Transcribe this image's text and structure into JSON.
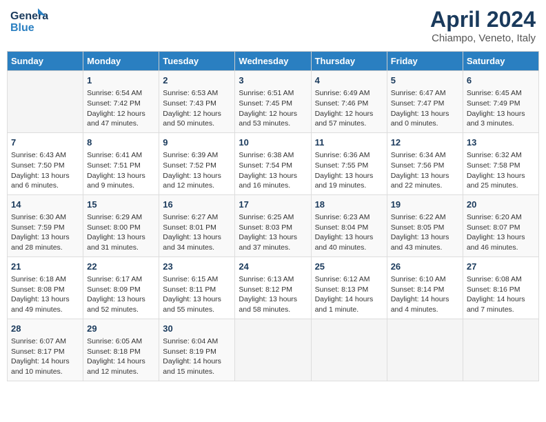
{
  "logo": {
    "line1": "General",
    "line2": "Blue"
  },
  "title": "April 2024",
  "subtitle": "Chiampo, Veneto, Italy",
  "weekdays": [
    "Sunday",
    "Monday",
    "Tuesday",
    "Wednesday",
    "Thursday",
    "Friday",
    "Saturday"
  ],
  "weeks": [
    [
      {
        "day": "",
        "info": ""
      },
      {
        "day": "1",
        "info": "Sunrise: 6:54 AM\nSunset: 7:42 PM\nDaylight: 12 hours\nand 47 minutes."
      },
      {
        "day": "2",
        "info": "Sunrise: 6:53 AM\nSunset: 7:43 PM\nDaylight: 12 hours\nand 50 minutes."
      },
      {
        "day": "3",
        "info": "Sunrise: 6:51 AM\nSunset: 7:45 PM\nDaylight: 12 hours\nand 53 minutes."
      },
      {
        "day": "4",
        "info": "Sunrise: 6:49 AM\nSunset: 7:46 PM\nDaylight: 12 hours\nand 57 minutes."
      },
      {
        "day": "5",
        "info": "Sunrise: 6:47 AM\nSunset: 7:47 PM\nDaylight: 13 hours\nand 0 minutes."
      },
      {
        "day": "6",
        "info": "Sunrise: 6:45 AM\nSunset: 7:49 PM\nDaylight: 13 hours\nand 3 minutes."
      }
    ],
    [
      {
        "day": "7",
        "info": "Sunrise: 6:43 AM\nSunset: 7:50 PM\nDaylight: 13 hours\nand 6 minutes."
      },
      {
        "day": "8",
        "info": "Sunrise: 6:41 AM\nSunset: 7:51 PM\nDaylight: 13 hours\nand 9 minutes."
      },
      {
        "day": "9",
        "info": "Sunrise: 6:39 AM\nSunset: 7:52 PM\nDaylight: 13 hours\nand 12 minutes."
      },
      {
        "day": "10",
        "info": "Sunrise: 6:38 AM\nSunset: 7:54 PM\nDaylight: 13 hours\nand 16 minutes."
      },
      {
        "day": "11",
        "info": "Sunrise: 6:36 AM\nSunset: 7:55 PM\nDaylight: 13 hours\nand 19 minutes."
      },
      {
        "day": "12",
        "info": "Sunrise: 6:34 AM\nSunset: 7:56 PM\nDaylight: 13 hours\nand 22 minutes."
      },
      {
        "day": "13",
        "info": "Sunrise: 6:32 AM\nSunset: 7:58 PM\nDaylight: 13 hours\nand 25 minutes."
      }
    ],
    [
      {
        "day": "14",
        "info": "Sunrise: 6:30 AM\nSunset: 7:59 PM\nDaylight: 13 hours\nand 28 minutes."
      },
      {
        "day": "15",
        "info": "Sunrise: 6:29 AM\nSunset: 8:00 PM\nDaylight: 13 hours\nand 31 minutes."
      },
      {
        "day": "16",
        "info": "Sunrise: 6:27 AM\nSunset: 8:01 PM\nDaylight: 13 hours\nand 34 minutes."
      },
      {
        "day": "17",
        "info": "Sunrise: 6:25 AM\nSunset: 8:03 PM\nDaylight: 13 hours\nand 37 minutes."
      },
      {
        "day": "18",
        "info": "Sunrise: 6:23 AM\nSunset: 8:04 PM\nDaylight: 13 hours\nand 40 minutes."
      },
      {
        "day": "19",
        "info": "Sunrise: 6:22 AM\nSunset: 8:05 PM\nDaylight: 13 hours\nand 43 minutes."
      },
      {
        "day": "20",
        "info": "Sunrise: 6:20 AM\nSunset: 8:07 PM\nDaylight: 13 hours\nand 46 minutes."
      }
    ],
    [
      {
        "day": "21",
        "info": "Sunrise: 6:18 AM\nSunset: 8:08 PM\nDaylight: 13 hours\nand 49 minutes."
      },
      {
        "day": "22",
        "info": "Sunrise: 6:17 AM\nSunset: 8:09 PM\nDaylight: 13 hours\nand 52 minutes."
      },
      {
        "day": "23",
        "info": "Sunrise: 6:15 AM\nSunset: 8:11 PM\nDaylight: 13 hours\nand 55 minutes."
      },
      {
        "day": "24",
        "info": "Sunrise: 6:13 AM\nSunset: 8:12 PM\nDaylight: 13 hours\nand 58 minutes."
      },
      {
        "day": "25",
        "info": "Sunrise: 6:12 AM\nSunset: 8:13 PM\nDaylight: 14 hours\nand 1 minute."
      },
      {
        "day": "26",
        "info": "Sunrise: 6:10 AM\nSunset: 8:14 PM\nDaylight: 14 hours\nand 4 minutes."
      },
      {
        "day": "27",
        "info": "Sunrise: 6:08 AM\nSunset: 8:16 PM\nDaylight: 14 hours\nand 7 minutes."
      }
    ],
    [
      {
        "day": "28",
        "info": "Sunrise: 6:07 AM\nSunset: 8:17 PM\nDaylight: 14 hours\nand 10 minutes."
      },
      {
        "day": "29",
        "info": "Sunrise: 6:05 AM\nSunset: 8:18 PM\nDaylight: 14 hours\nand 12 minutes."
      },
      {
        "day": "30",
        "info": "Sunrise: 6:04 AM\nSunset: 8:19 PM\nDaylight: 14 hours\nand 15 minutes."
      },
      {
        "day": "",
        "info": ""
      },
      {
        "day": "",
        "info": ""
      },
      {
        "day": "",
        "info": ""
      },
      {
        "day": "",
        "info": ""
      }
    ]
  ]
}
